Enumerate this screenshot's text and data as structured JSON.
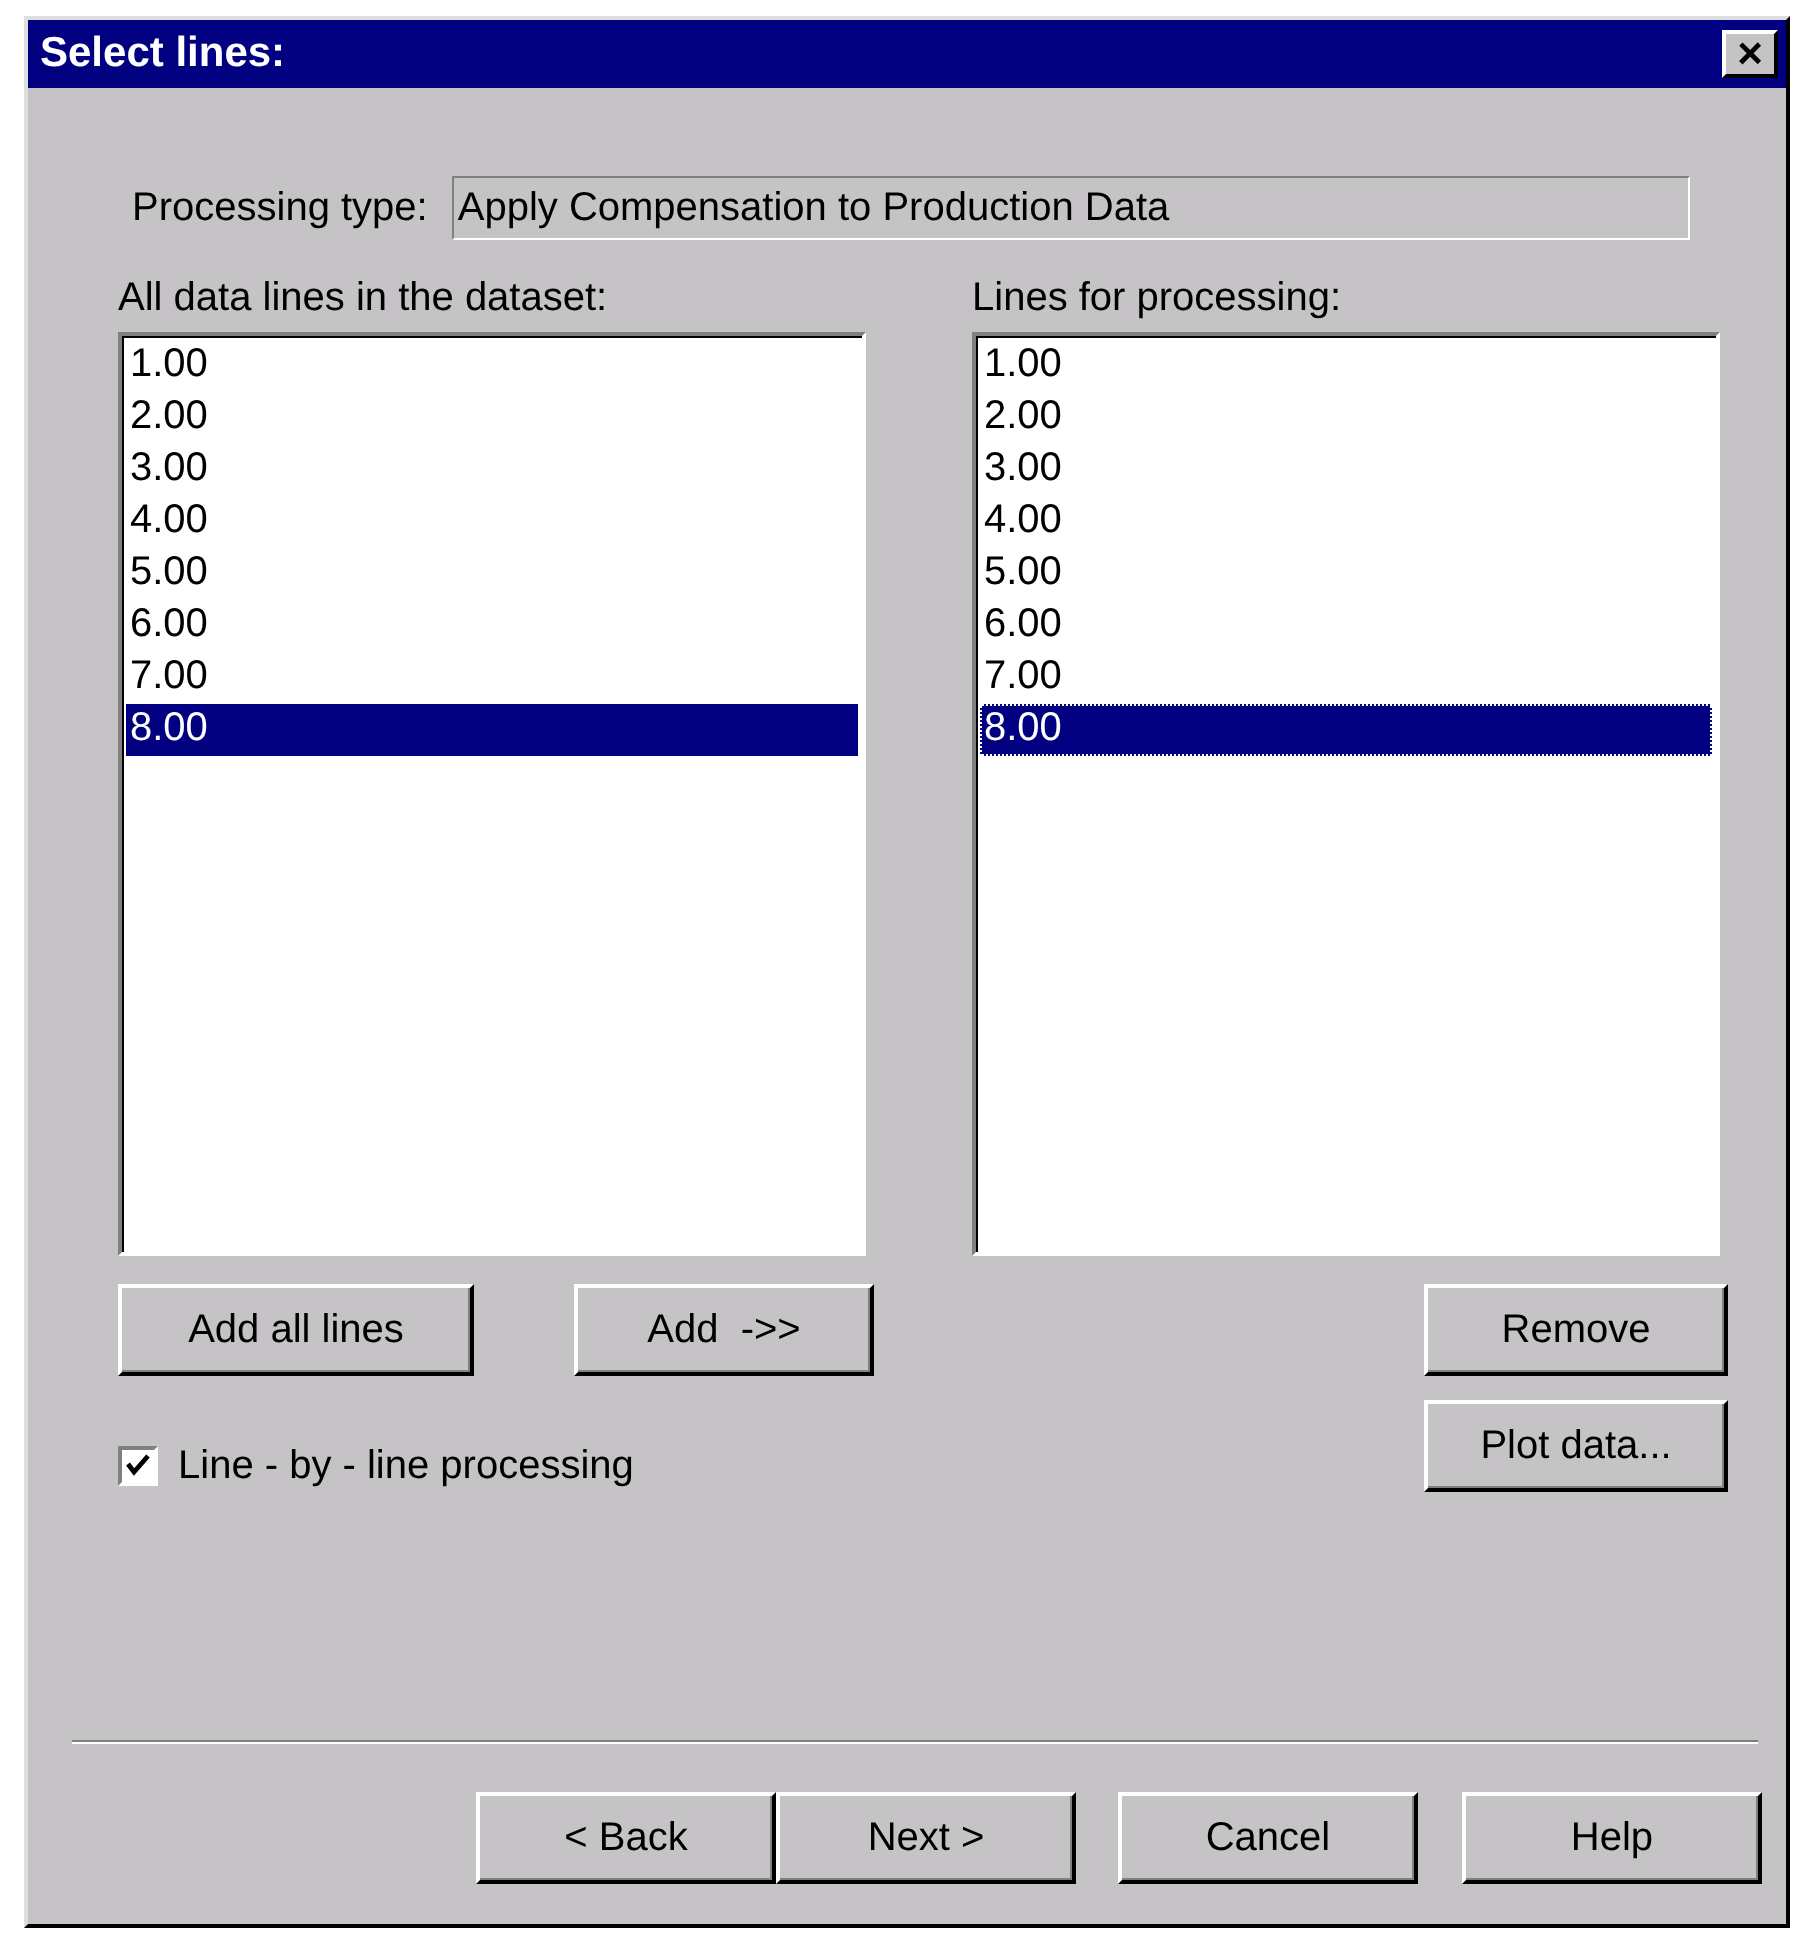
{
  "window": {
    "title": "Select lines:",
    "close": "×"
  },
  "processing_type": {
    "label": "Processing type:",
    "value": "Apply Compensation to Production Data"
  },
  "all_lines": {
    "label": "All data lines in the dataset:",
    "focused": false,
    "items": [
      {
        "text": "1.00",
        "selected": false
      },
      {
        "text": "2.00",
        "selected": false
      },
      {
        "text": "3.00",
        "selected": false
      },
      {
        "text": "4.00",
        "selected": false
      },
      {
        "text": "5.00",
        "selected": false
      },
      {
        "text": "6.00",
        "selected": false
      },
      {
        "text": "7.00",
        "selected": false
      },
      {
        "text": "8.00",
        "selected": true
      }
    ]
  },
  "processing_lines": {
    "label": "Lines for processing:",
    "focused": true,
    "items": [
      {
        "text": "1.00",
        "selected": false
      },
      {
        "text": "2.00",
        "selected": false
      },
      {
        "text": "3.00",
        "selected": false
      },
      {
        "text": "4.00",
        "selected": false
      },
      {
        "text": "5.00",
        "selected": false
      },
      {
        "text": "6.00",
        "selected": false
      },
      {
        "text": "7.00",
        "selected": false
      },
      {
        "text": "8.00",
        "selected": true
      }
    ]
  },
  "left_buttons": [
    "Add all lines",
    "Add  ->>"
  ],
  "right_buttons": [
    "Remove",
    "Plot data..."
  ],
  "line_by_line": {
    "label": "Line - by - line processing",
    "checked": true
  },
  "footer_buttons": [
    "< Back",
    "Next >",
    "Cancel",
    "Help"
  ]
}
